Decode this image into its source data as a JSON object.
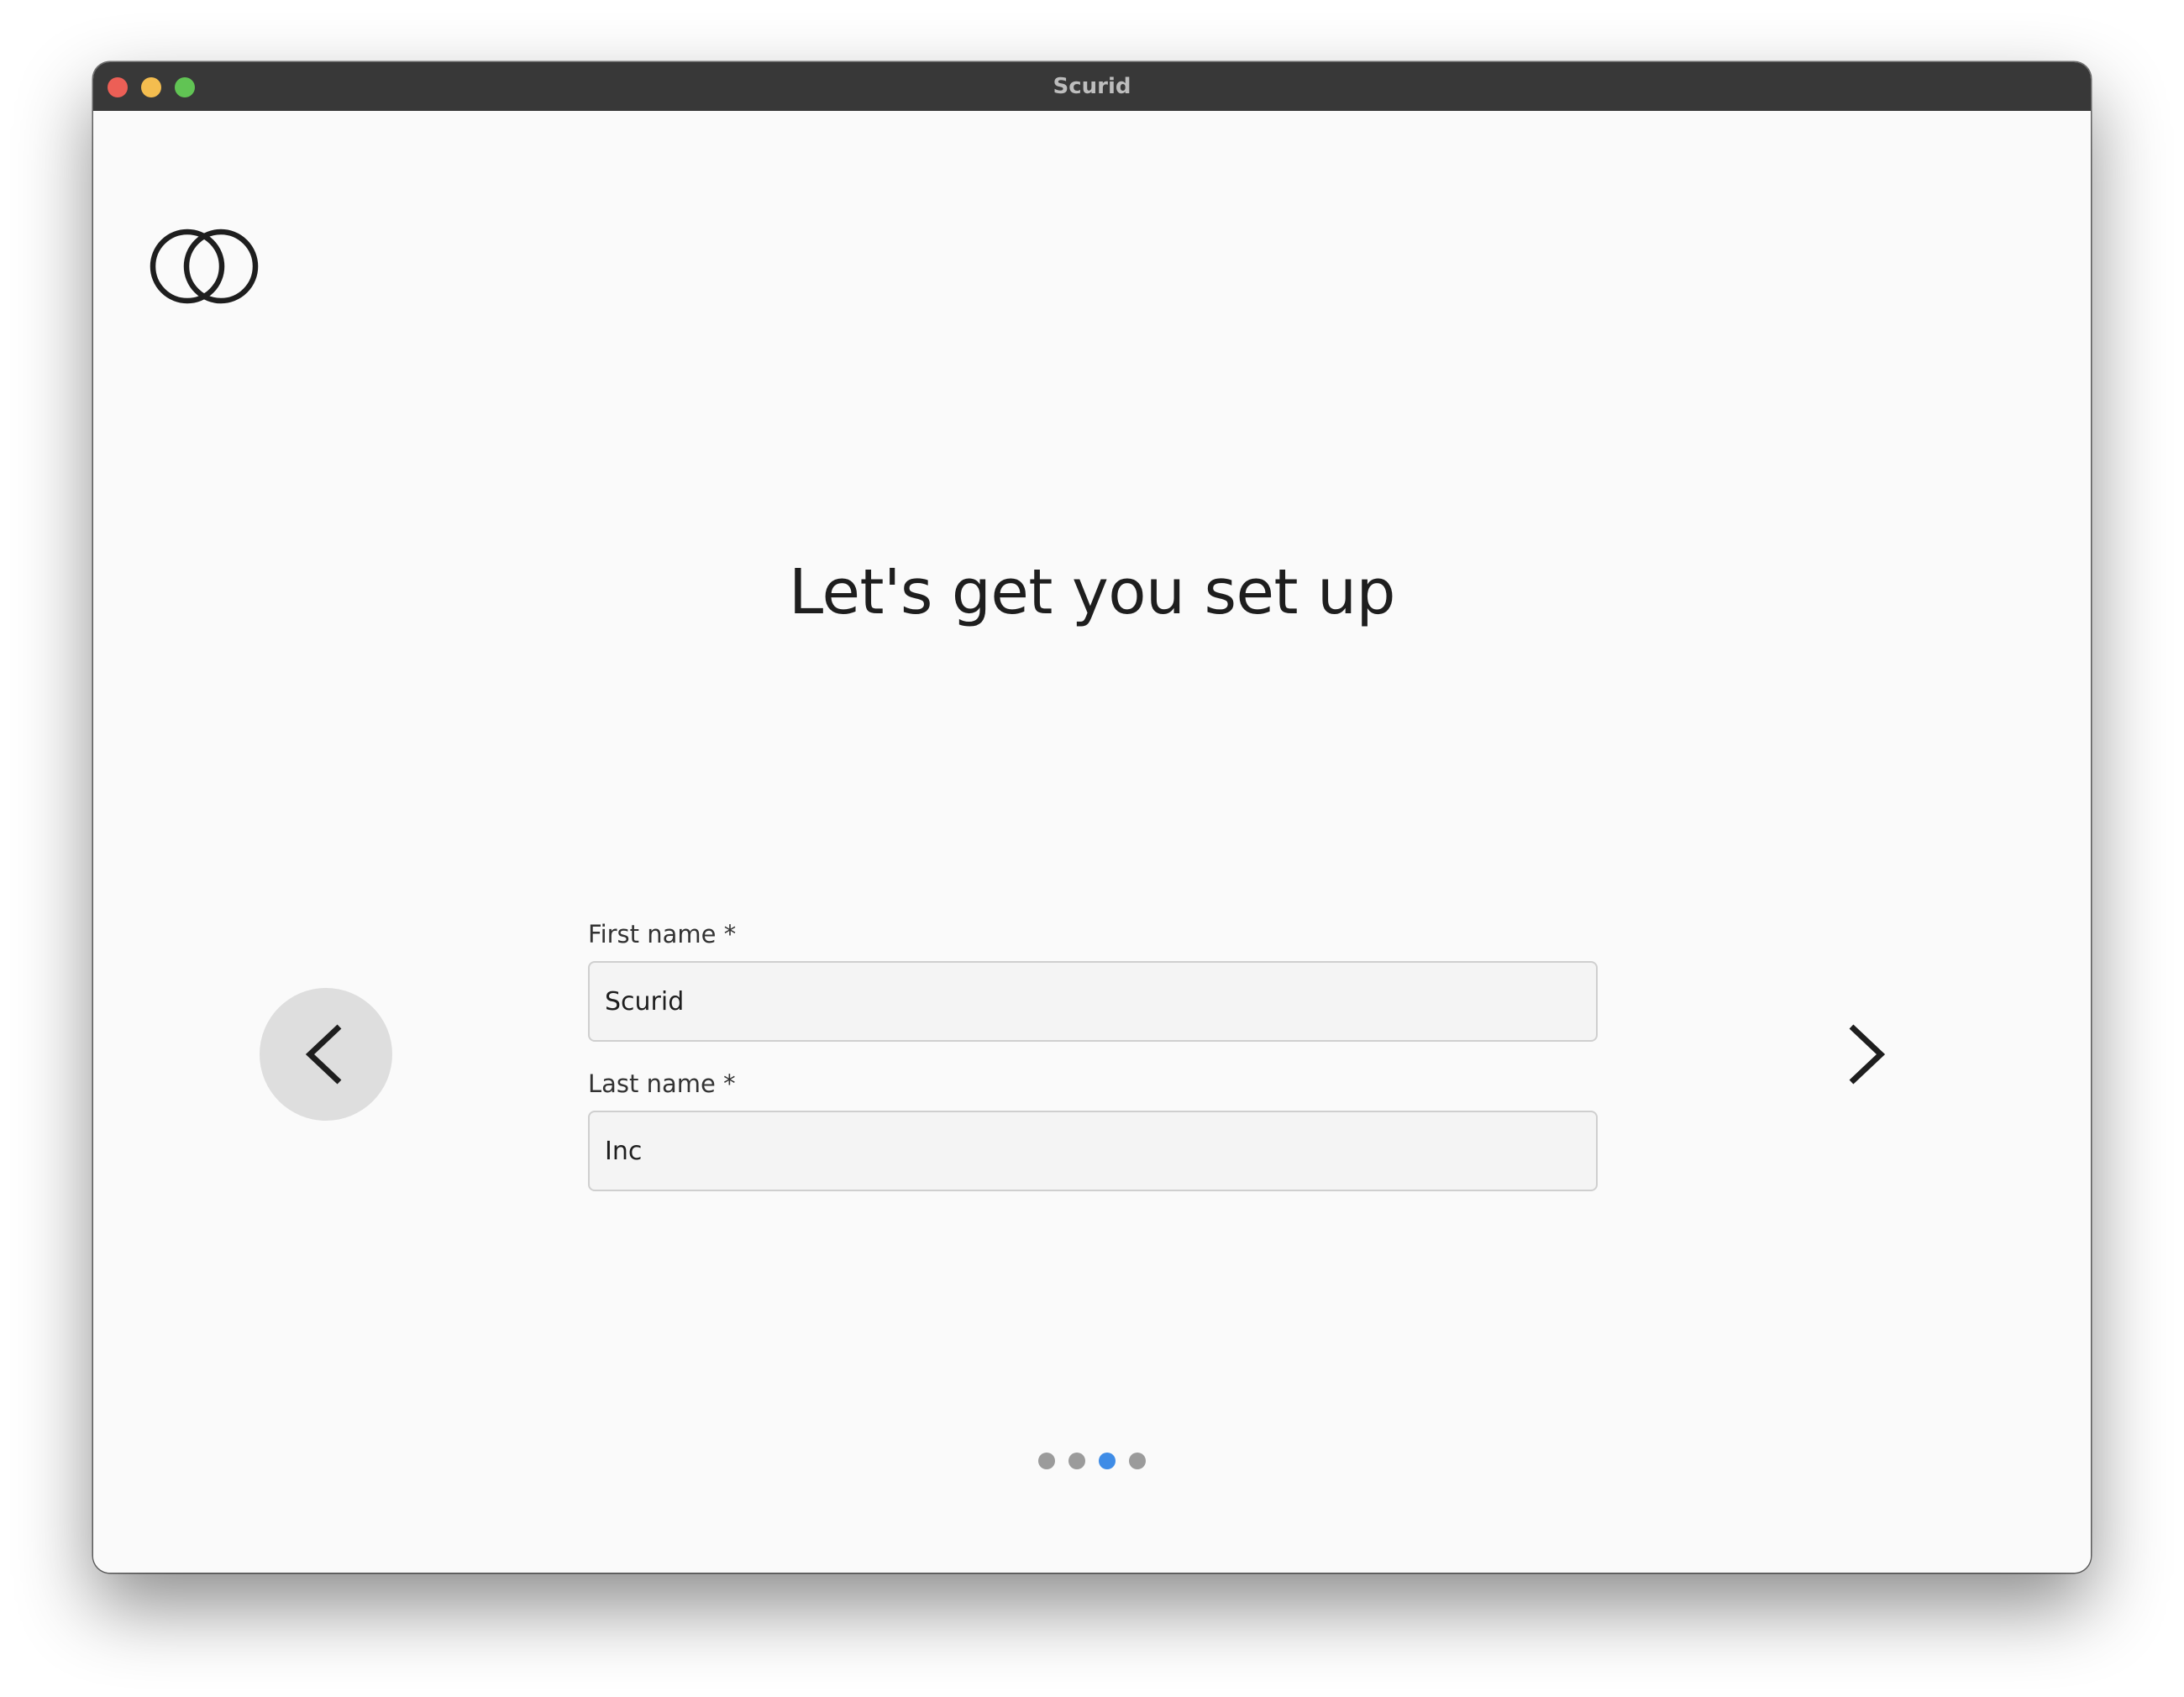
{
  "window": {
    "title": "Scurid",
    "controls": [
      {
        "name": "close",
        "color": "#ec5f56"
      },
      {
        "name": "minimize",
        "color": "#f4bd4f"
      },
      {
        "name": "maximize",
        "color": "#61c454"
      }
    ]
  },
  "logo": {
    "icon": "interlocked-circles-logo"
  },
  "main": {
    "heading": "Let's get you set up"
  },
  "form": {
    "first_name": {
      "label": "First name *",
      "value": "Scurid"
    },
    "last_name": {
      "label": "Last name *",
      "value": "Inc"
    }
  },
  "navigation": {
    "prev_icon": "chevron-left-icon",
    "next_icon": "chevron-right-icon"
  },
  "pagination": {
    "total": 4,
    "current": 3,
    "active_color": "#3f8ce6",
    "inactive_color": "#9b9b9b"
  },
  "colors": {
    "titlebar": "#383838",
    "background": "#fafafa",
    "text": "#1e1e1e"
  }
}
